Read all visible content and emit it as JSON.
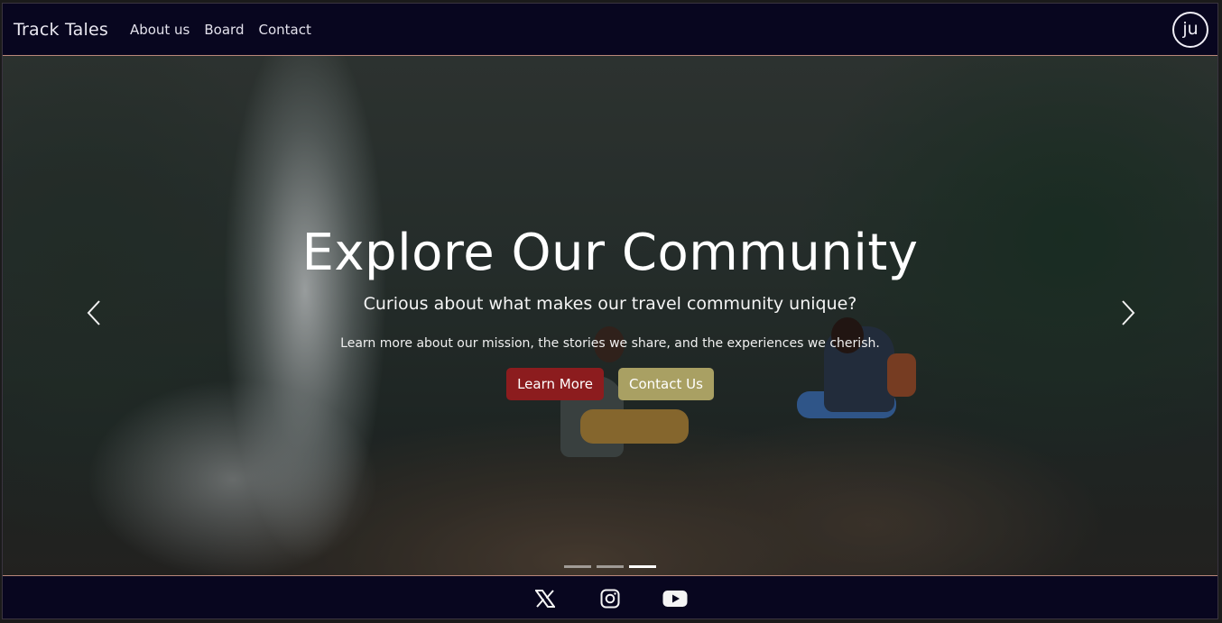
{
  "navbar": {
    "brand": "Track Tales",
    "links": [
      "About us",
      "Board",
      "Contact"
    ],
    "avatar_initials": "ju"
  },
  "hero": {
    "title": "Explore Our Community",
    "subtitle": "Curious about what makes our travel community unique?",
    "description": "Learn more about our mission, the stories we share, and the experiences we cherish.",
    "primary_button": "Learn More",
    "secondary_button": "Contact Us",
    "slide_count": 3,
    "active_slide": 3
  },
  "footer": {
    "social_icons": [
      "x-icon",
      "instagram-icon",
      "youtube-icon"
    ]
  },
  "colors": {
    "navbar_bg": "#08061f",
    "primary_button": "#8c1c1e",
    "secondary_button": "#a9a063",
    "accent_border": "#b9877a"
  }
}
